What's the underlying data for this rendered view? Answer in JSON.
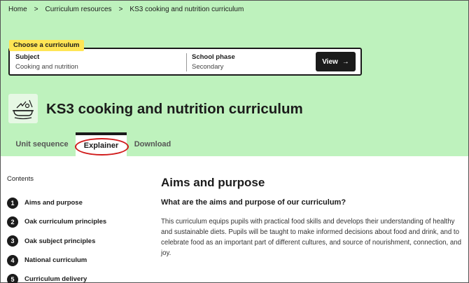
{
  "breadcrumb": {
    "items": [
      "Home",
      "Curriculum resources",
      "KS3 cooking and nutrition curriculum"
    ],
    "separator": ">"
  },
  "picker": {
    "tag": "Choose a curriculum",
    "subject_label": "Subject",
    "subject_value": "Cooking and nutrition",
    "phase_label": "School phase",
    "phase_value": "Secondary",
    "view_label": "View",
    "view_arrow": "→"
  },
  "page_title": "KS3 cooking and nutrition curriculum",
  "tabs": [
    {
      "label": "Unit sequence",
      "active": false
    },
    {
      "label": "Explainer",
      "active": true
    },
    {
      "label": "Download",
      "active": false
    }
  ],
  "contents": {
    "title": "Contents",
    "items": [
      {
        "num": "1",
        "label": "Aims and purpose"
      },
      {
        "num": "2",
        "label": "Oak curriculum principles"
      },
      {
        "num": "3",
        "label": "Oak subject principles"
      },
      {
        "num": "4",
        "label": "National curriculum"
      },
      {
        "num": "5",
        "label": "Curriculum delivery"
      }
    ]
  },
  "main": {
    "heading": "Aims and purpose",
    "subheading": "What are the aims and purpose of our curriculum?",
    "paragraph": "This curriculum equips pupils with practical food skills and develops their understanding of healthy and sustainable diets. Pupils will be taught to make informed decisions about food and drink, and to celebrate food as an important part of different cultures, and source of nourishment, connection, and joy."
  },
  "colors": {
    "hero_bg": "#bef2bd",
    "tag_bg": "#ffe555",
    "annotation": "#d11c1c"
  },
  "icons": {
    "subject": "cooking-pot-icon",
    "view": "arrow-right-icon"
  }
}
